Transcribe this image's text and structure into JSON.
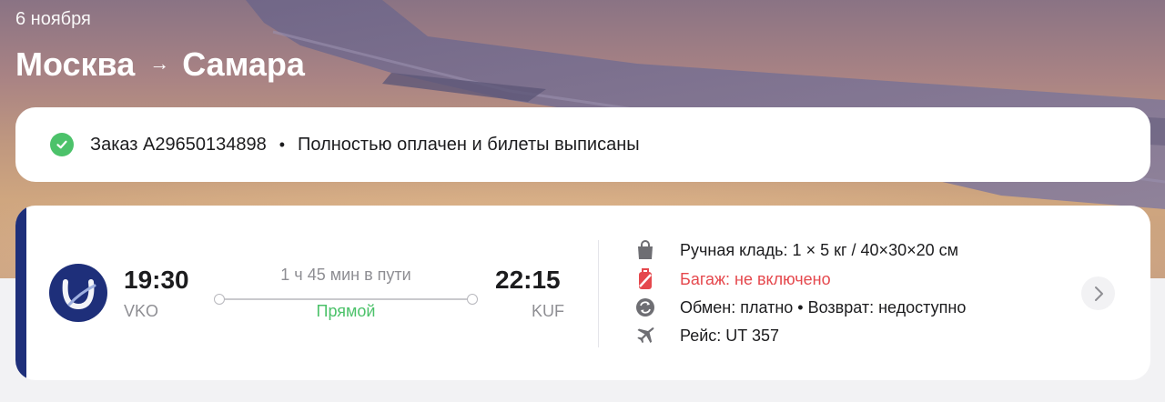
{
  "header": {
    "date": "6 ноября",
    "from_city": "Москва",
    "arrow": "→",
    "to_city": "Самара"
  },
  "order": {
    "number_label": "Заказ A29650134898",
    "separator": "•",
    "status": "Полностью оплачен и билеты выписаны",
    "status_color": "#4cc26a"
  },
  "flight": {
    "airline_color": "#1e2f7a",
    "departure": {
      "time": "19:30",
      "code": "VKO"
    },
    "arrival": {
      "time": "22:15",
      "code": "KUF"
    },
    "duration": "1 ч 45 мин в пути",
    "stops": "Прямой",
    "details": {
      "carry_on": "Ручная кладь: 1 × 5 кг / 40×30×20 см",
      "baggage": "Багаж: не включено",
      "exchange": "Обмен: платно • Возврат: недоступно",
      "flight_number": "Рейс: UT 357"
    },
    "icons": [
      "bag-icon",
      "baggage-not-included-icon",
      "exchange-icon",
      "plane-icon",
      "chevron-right-icon"
    ]
  }
}
